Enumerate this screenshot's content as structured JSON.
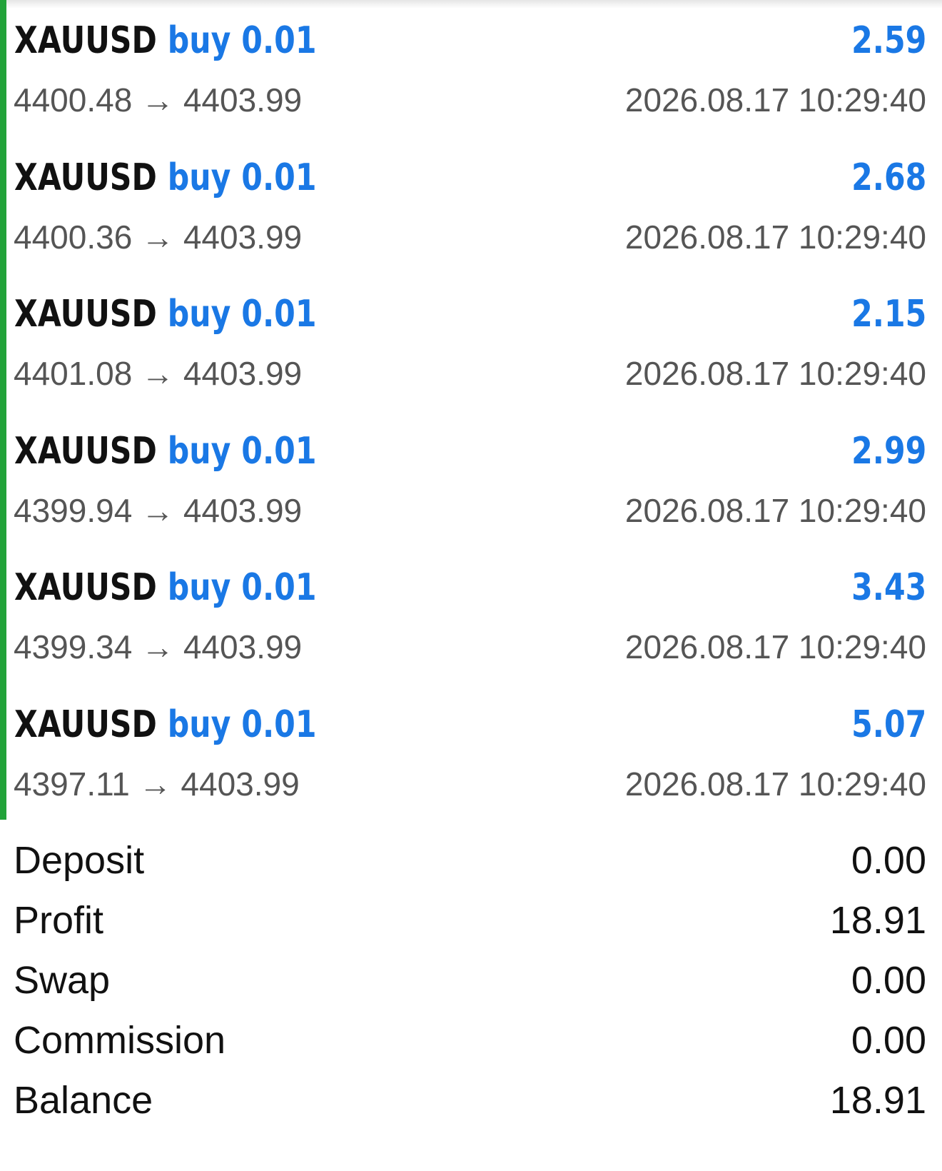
{
  "deals": [
    {
      "symbol": "XAUUSD",
      "side": "buy",
      "volume": "0.01",
      "profit": "2.59",
      "prices": "4400.48 → 4403.99",
      "time": "2026.08.17 10:29:40"
    },
    {
      "symbol": "XAUUSD",
      "side": "buy",
      "volume": "0.01",
      "profit": "2.68",
      "prices": "4400.36 → 4403.99",
      "time": "2026.08.17 10:29:40"
    },
    {
      "symbol": "XAUUSD",
      "side": "buy",
      "volume": "0.01",
      "profit": "2.15",
      "prices": "4401.08 → 4403.99",
      "time": "2026.08.17 10:29:40"
    },
    {
      "symbol": "XAUUSD",
      "side": "buy",
      "volume": "0.01",
      "profit": "2.99",
      "prices": "4399.94 → 4403.99",
      "time": "2026.08.17 10:29:40"
    },
    {
      "symbol": "XAUUSD",
      "side": "buy",
      "volume": "0.01",
      "profit": "3.43",
      "prices": "4399.34 → 4403.99",
      "time": "2026.08.17 10:29:40"
    },
    {
      "symbol": "XAUUSD",
      "side": "buy",
      "volume": "0.01",
      "profit": "5.07",
      "prices": "4397.11 → 4403.99",
      "time": "2026.08.17 10:29:40"
    }
  ],
  "summary": [
    {
      "label": "Deposit",
      "value": "0.00"
    },
    {
      "label": "Profit",
      "value": "18.91"
    },
    {
      "label": "Swap",
      "value": "0.00"
    },
    {
      "label": "Commission",
      "value": "0.00"
    },
    {
      "label": "Balance",
      "value": "18.91"
    }
  ],
  "colors": {
    "accent_blue": "#1a78e5",
    "group_indicator_green": "#22a33a",
    "secondary_text": "#555555",
    "primary_text": "#111111"
  }
}
